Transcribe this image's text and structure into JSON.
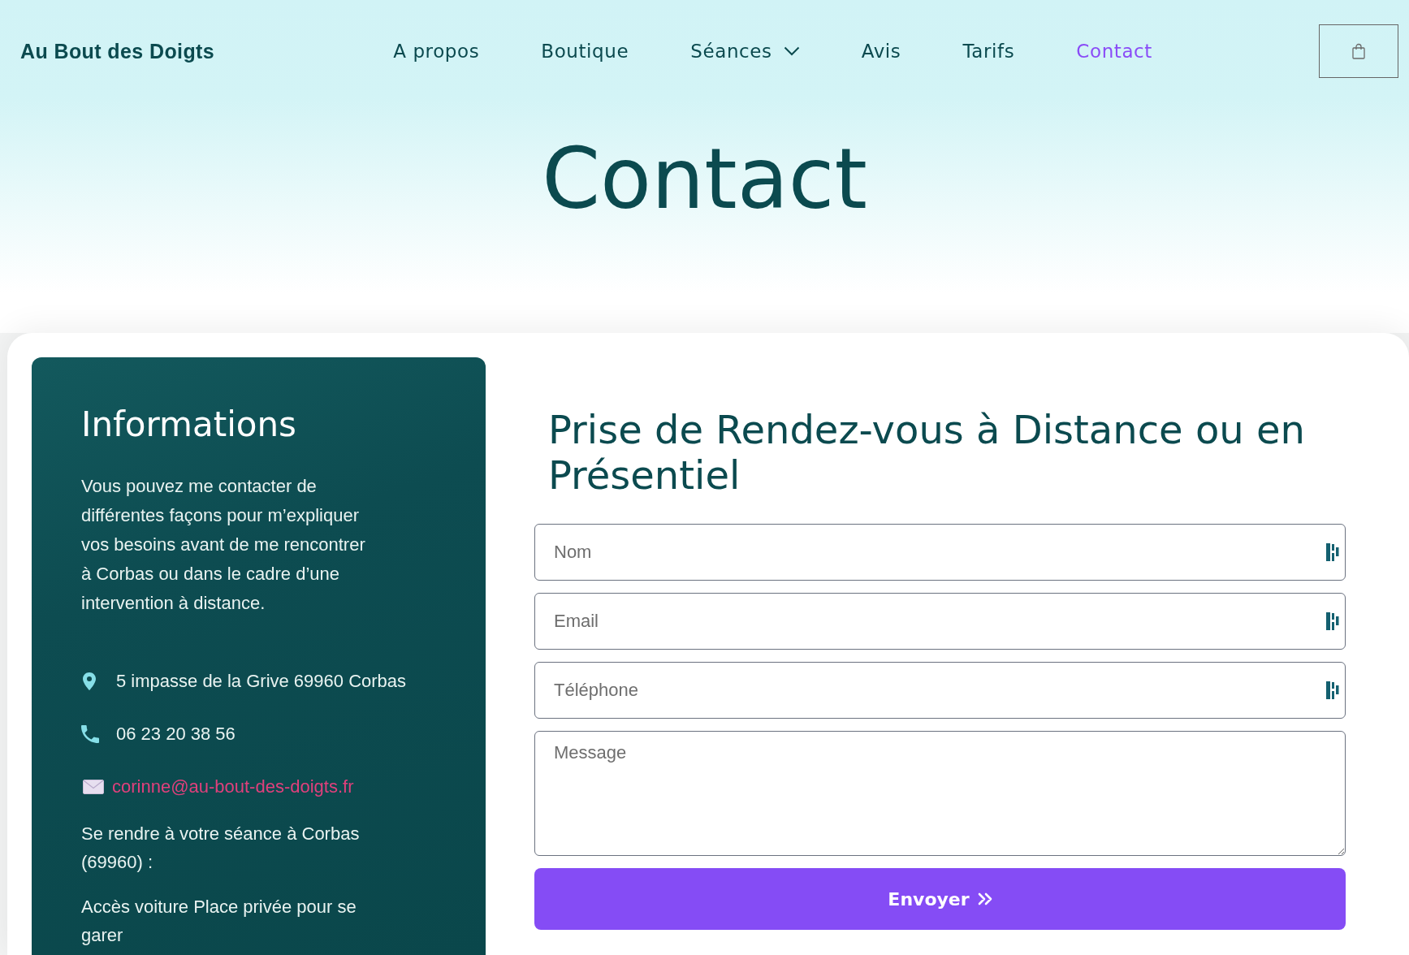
{
  "header": {
    "logo": "Au Bout des Doigts",
    "nav": [
      {
        "label": "A propos",
        "selected": false,
        "dropdown": false
      },
      {
        "label": "Boutique",
        "selected": false,
        "dropdown": false
      },
      {
        "label": "Séances",
        "selected": false,
        "dropdown": true
      },
      {
        "label": "Avis",
        "selected": false,
        "dropdown": false
      },
      {
        "label": "Tarifs",
        "selected": false,
        "dropdown": false
      },
      {
        "label": "Contact",
        "selected": true,
        "dropdown": false
      }
    ]
  },
  "hero": {
    "title": "Contact"
  },
  "info_panel": {
    "title": "Informations",
    "intro": "Vous pouvez me contacter de différentes façons pour m’expliquer vos besoins avant de me rencontrer à Corbas ou dans le cadre d’une intervention à distance.",
    "contacts": [
      {
        "kind": "address",
        "text": "5 impasse de la Grive 69960 Corbas"
      },
      {
        "kind": "phone",
        "text": "06 23 20 38 56"
      },
      {
        "kind": "email",
        "text": "corinne@au-bout-des-doigts.fr"
      }
    ],
    "notes": [
      "Se rendre à votre séance à Corbas (69960) :",
      "Accès voiture Place privée pour se garer"
    ]
  },
  "form": {
    "title": "Prise de Rendez-vous à Distance ou en Présentiel",
    "fields": [
      {
        "kind": "input",
        "placeholder": "Nom"
      },
      {
        "kind": "input",
        "placeholder": "Email"
      },
      {
        "kind": "input",
        "placeholder": "Téléphone"
      },
      {
        "kind": "textarea",
        "placeholder": "Message"
      }
    ],
    "submit": "Envoyer"
  }
}
